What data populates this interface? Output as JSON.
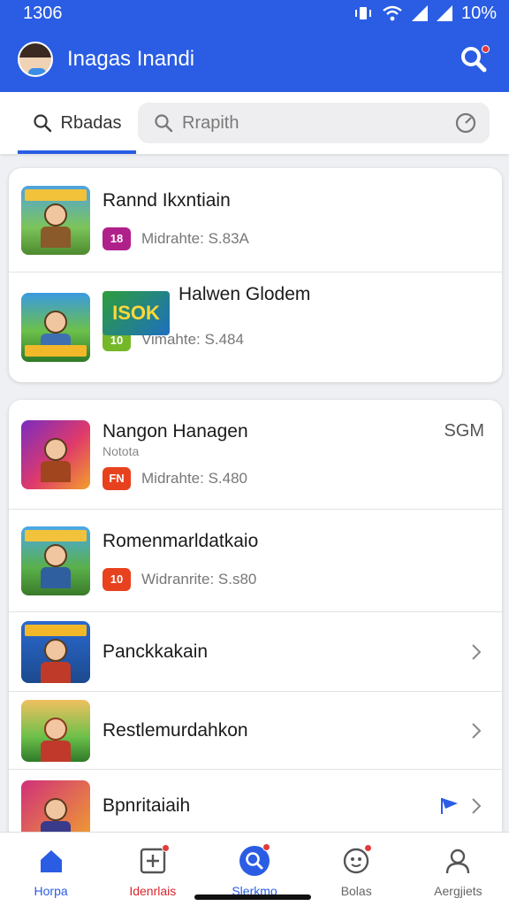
{
  "status": {
    "time": "1306",
    "battery": "10%"
  },
  "header": {
    "title": "Inagas Inandi"
  },
  "tabs": {
    "active_label": "Rbadas"
  },
  "search": {
    "placeholder": "Rrapith"
  },
  "section1": {
    "items": [
      {
        "title": "Rannd Ikxntiain",
        "meta": "Midrahte: S.83A",
        "badge": "18",
        "badge_color": "#b0208a"
      },
      {
        "title": "Halwen Glodem",
        "meta": "Vimahte: S.484",
        "badge": "10",
        "badge_color": "#74b82a",
        "logo_text": "ISOK"
      }
    ]
  },
  "section2": {
    "items": [
      {
        "title": "Nangon Hanagen",
        "subtitle": "Notota",
        "meta": "Midrahte: S.480",
        "side": "SGM",
        "badge": "FN",
        "badge_color": "#e8411e"
      },
      {
        "title": "Romenmarldatkaio",
        "meta": "Widranrite: S.s80",
        "badge": "10",
        "badge_color": "#e8411e"
      },
      {
        "title": "Panckkakain"
      },
      {
        "title": "Restlemurdahkon"
      },
      {
        "title": "Bpnritaiaih"
      }
    ]
  },
  "nav": {
    "items": [
      {
        "label": "Horpa",
        "color": "#2a5de4",
        "icon": "home-icon"
      },
      {
        "label": "Idenrlais",
        "color": "#d8262c",
        "icon": "add-box-icon"
      },
      {
        "label": "Slerkmo",
        "color": "#2a5de4",
        "icon": "search-badge-icon"
      },
      {
        "label": "Bolas",
        "color": "#666666",
        "icon": "rewards-icon"
      },
      {
        "label": "Aergjiets",
        "color": "#666666",
        "icon": "account-icon"
      }
    ]
  },
  "colors": {
    "primary": "#2a5de4",
    "notification": "#e23b3b"
  }
}
